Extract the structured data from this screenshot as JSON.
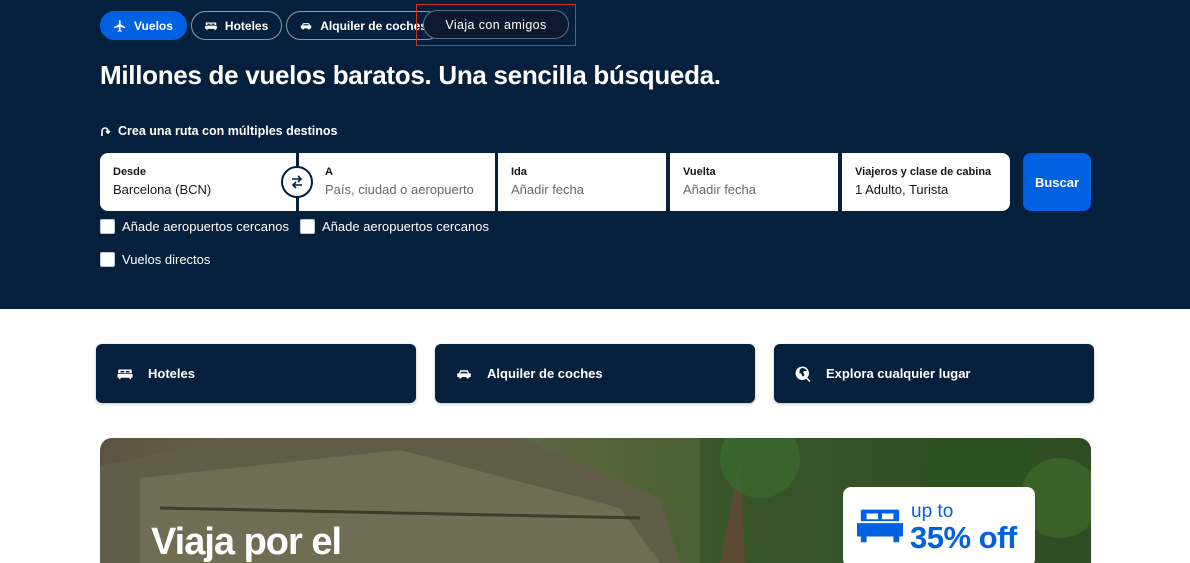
{
  "tabs": [
    {
      "label": "Vuelos",
      "icon": "plane-icon",
      "active": true
    },
    {
      "label": "Hoteles",
      "icon": "bed-icon",
      "active": false
    },
    {
      "label": "Alquiler de coches",
      "icon": "car-icon",
      "active": false
    }
  ],
  "friends_tab": {
    "label": "Viaja con amigos"
  },
  "headline": "Millones de vuelos baratos. Una sencilla búsqueda.",
  "multi_city": {
    "label": "Crea una ruta con múltiples destinos",
    "icon": "route-icon"
  },
  "search": {
    "from": {
      "label": "Desde",
      "value": "Barcelona (BCN)"
    },
    "to": {
      "label": "A",
      "placeholder": "País, ciudad o aeropuerto"
    },
    "depart": {
      "label": "Ida",
      "placeholder": "Añadir fecha"
    },
    "return": {
      "label": "Vuelta",
      "placeholder": "Añadir fecha"
    },
    "travellers": {
      "label": "Viajeros y clase de cabina",
      "value": "1 Adulto, Turista"
    },
    "button": "Buscar"
  },
  "checkboxes": {
    "nearby_origin": "Añade aeropuertos cercanos",
    "nearby_destination": "Añade aeropuertos cercanos",
    "direct": "Vuelos directos"
  },
  "cards": [
    {
      "label": "Hoteles",
      "icon": "bed-icon"
    },
    {
      "label": "Alquiler de coches",
      "icon": "car-icon"
    },
    {
      "label": "Explora cualquier lugar",
      "icon": "globe-search-icon"
    }
  ],
  "promo": {
    "title": "Viaja por el",
    "badge_line1": "up to",
    "badge_line2": "35% off",
    "badge_icon": "bed-icon"
  },
  "colors": {
    "hero_bg": "#05203c",
    "accent": "#0062e3",
    "highlight_border": "#d8301e"
  }
}
